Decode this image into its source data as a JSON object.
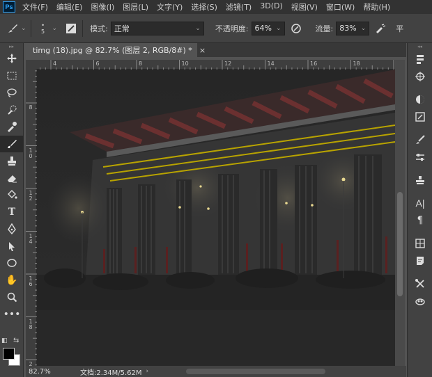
{
  "app": {
    "logo": "Ps"
  },
  "menu": [
    "文件(F)",
    "编辑(E)",
    "图像(I)",
    "图层(L)",
    "文字(Y)",
    "选择(S)",
    "滤镜(T)",
    "3D(D)",
    "视图(V)",
    "窗口(W)",
    "帮助(H)"
  ],
  "options": {
    "brush_size": "5",
    "mode_label": "模式:",
    "mode_value": "正常",
    "opacity_label": "不透明度:",
    "opacity_value": "64%",
    "flow_label": "流量:",
    "flow_value": "83%",
    "smoothing_label": "平"
  },
  "document": {
    "tab_title": "timg (18).jpg @ 82.7% (图层 2, RGB/8#) *",
    "close": "×"
  },
  "ruler": {
    "h_labels": [
      "4",
      "6",
      "8",
      "10",
      "12",
      "14",
      "16",
      "18",
      "20"
    ],
    "v_labels": [
      "8",
      "1 0",
      "1 2",
      "1 4",
      "1 6",
      "1 8",
      "2 0"
    ]
  },
  "status": {
    "zoom": "82.7%",
    "doc_info": "文档:2.34M/5.62M"
  },
  "icons": {
    "tools": [
      "move-icon",
      "marquee-icon",
      "lasso-icon",
      "quick-select-icon",
      "eyedropper-icon",
      "brush-icon",
      "stamp-icon",
      "eraser-icon",
      "paint-bucket-icon",
      "text-icon",
      "pen-icon",
      "path-select-icon",
      "ellipse-icon",
      "hand-icon",
      "zoom-icon",
      "more-icon"
    ],
    "dock": [
      "history-icon",
      "navigator-icon",
      "color-icon",
      "swatches-icon",
      "brushes-icon",
      "adjustments-icon",
      "clone-source-icon",
      "character-icon",
      "paragraph-icon",
      "layers-icon",
      "notes-icon",
      "tools-preset-icon",
      "libraries-icon"
    ]
  },
  "colors": {
    "foreground": "#000000",
    "background": "#ffffff",
    "accent": "#31a8ff"
  }
}
